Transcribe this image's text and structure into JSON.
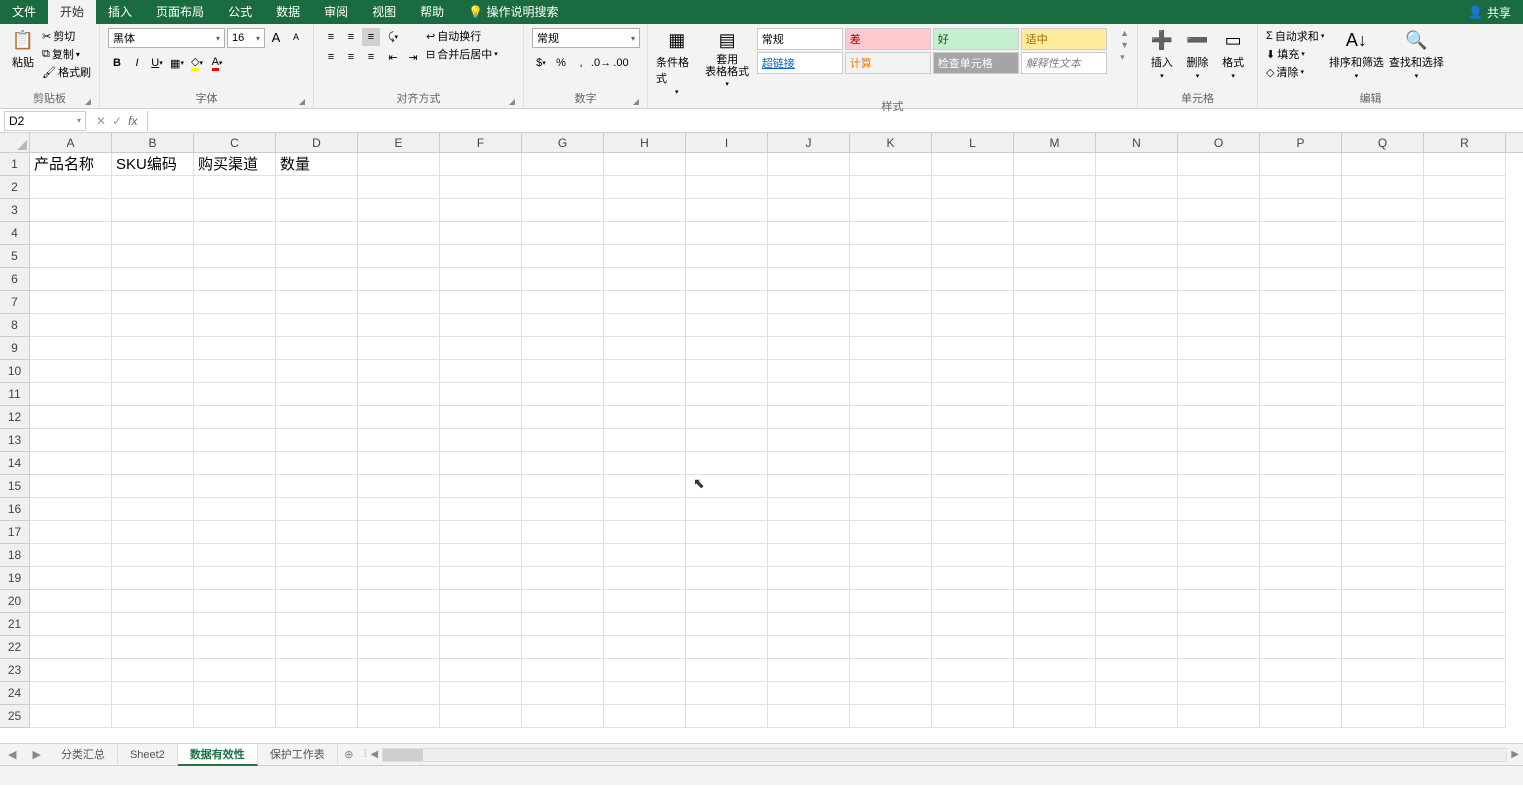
{
  "menu": {
    "file": "文件",
    "home": "开始",
    "insert": "插入",
    "layout": "页面布局",
    "formula": "公式",
    "data": "数据",
    "review": "审阅",
    "view": "视图",
    "help": "帮助",
    "tell": "操作说明搜索",
    "share": "共享"
  },
  "ribbon": {
    "clipboard": {
      "label": "剪贴板",
      "cut": "剪切",
      "copy": "复制",
      "painter": "格式刷",
      "paste": "粘贴"
    },
    "font": {
      "label": "字体",
      "name": "黑体",
      "size": "16"
    },
    "align": {
      "label": "对齐方式",
      "wrap": "自动换行",
      "merge": "合并后居中"
    },
    "number": {
      "label": "数字",
      "format": "常规"
    },
    "styles": {
      "label": "样式",
      "cond": "条件格式",
      "table": "套用\n表格格式",
      "items": [
        {
          "t": "常规",
          "bg": "#ffffff",
          "c": "#000"
        },
        {
          "t": "差",
          "bg": "#ffc7ce",
          "c": "#9c0006"
        },
        {
          "t": "好",
          "bg": "#c6efce",
          "c": "#006100"
        },
        {
          "t": "适中",
          "bg": "#ffeb9c",
          "c": "#9c6500"
        },
        {
          "t": "超链接",
          "bg": "#ffffff",
          "c": "#0563c1"
        },
        {
          "t": "计算",
          "bg": "#f2f2f2",
          "c": "#fa7d00"
        },
        {
          "t": "检查单元格",
          "bg": "#a5a5a5",
          "c": "#ffffff"
        },
        {
          "t": "解释性文本",
          "bg": "#ffffff",
          "c": "#7f7f7f"
        }
      ]
    },
    "cells": {
      "label": "单元格",
      "insert": "插入",
      "delete": "删除",
      "format": "格式"
    },
    "editing": {
      "label": "编辑",
      "sum": "自动求和",
      "fill": "填充",
      "clear": "清除",
      "sort": "排序和筛选",
      "find": "查找和选择"
    }
  },
  "formula_bar": {
    "cell_ref": "D2",
    "value": ""
  },
  "columns": [
    "A",
    "B",
    "C",
    "D",
    "E",
    "F",
    "G",
    "H",
    "I",
    "J",
    "K",
    "L",
    "M",
    "N",
    "O",
    "P",
    "Q",
    "R"
  ],
  "rows": 25,
  "headers": [
    "产品名称",
    "SKU编码",
    "购买渠道",
    "数量"
  ],
  "sheet_tabs": [
    {
      "name": "分类汇总",
      "active": false
    },
    {
      "name": "Sheet2",
      "active": false
    },
    {
      "name": "数据有效性",
      "active": true
    },
    {
      "name": "保护工作表",
      "active": false
    }
  ]
}
